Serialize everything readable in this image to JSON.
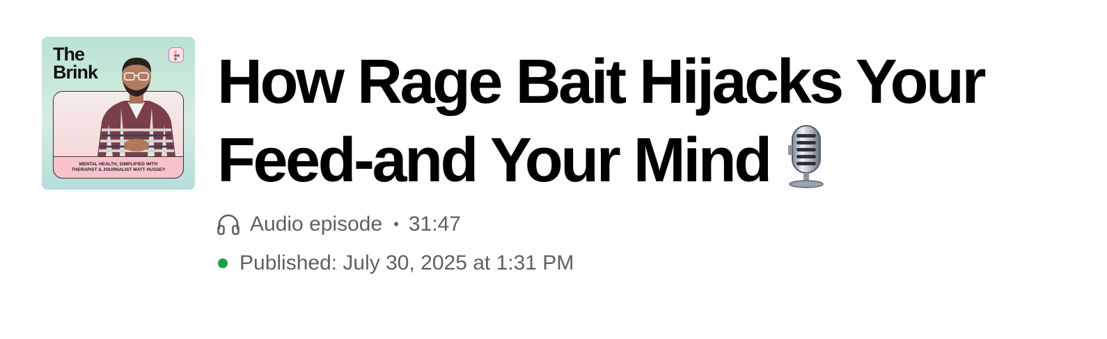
{
  "episode": {
    "title": "How Rage Bait Hijacks Your Feed-and Your Mind",
    "title_icon": "microphone-emoji-icon",
    "type_label": "Audio episode",
    "type_icon": "headphones-icon",
    "separator": "•",
    "duration": "31:47",
    "published": "Published: July 30, 2025 at 1:31 PM",
    "status_color": "#1e9e4a"
  },
  "cover": {
    "title_line1": "The",
    "title_line2": "Brink",
    "caption": "MENTAL HEALTH, SIMPLIFIED WITH\nTHERAPIST & JOURNALIST MATT HUSSEY",
    "badge_icon": "app-logo-icon"
  }
}
